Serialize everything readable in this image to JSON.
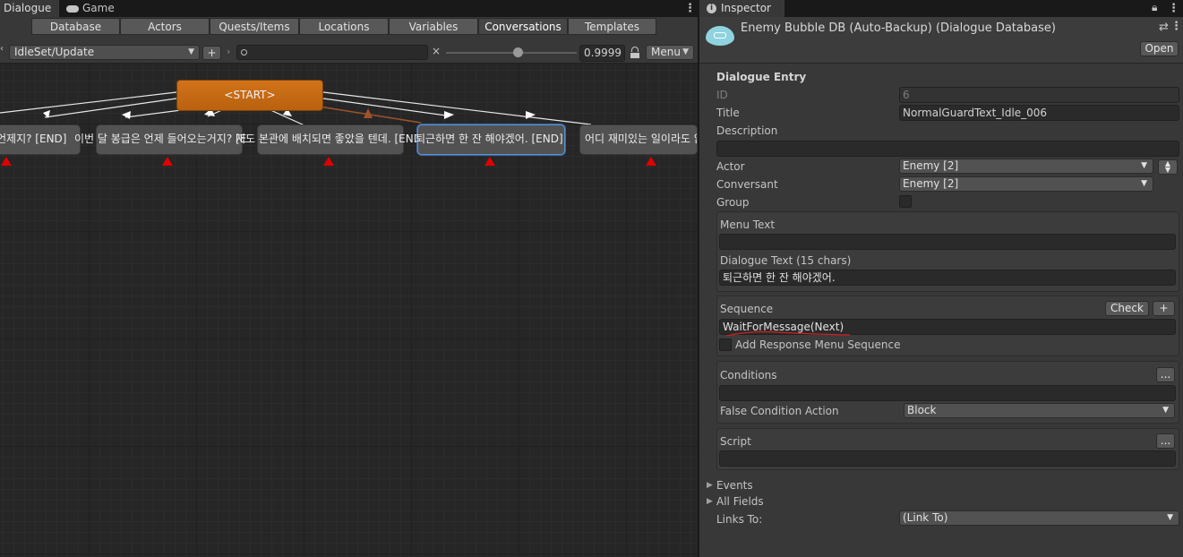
{
  "window_tabs": {
    "dialogue": "Dialogue",
    "game": "Game"
  },
  "db_tabs": [
    "Database",
    "Actors",
    "Quests/Items",
    "Locations",
    "Variables",
    "Conversations",
    "Templates"
  ],
  "conversation_select": "IdleSet/Update",
  "add_label": "+",
  "search": {
    "value": "",
    "clear": "×"
  },
  "zoom_value": "0.9999",
  "zoom_level": 0.55,
  "menu_label": "Menu",
  "start_node": "<START>",
  "nodes": [
    {
      "text": " 언제지? [END]"
    },
    {
      "text": "이번 달 봉급은 언제 들어오는거지? [END]"
    },
    {
      "text": "저도 본관에 배치되면 좋았을 텐데. [END]"
    },
    {
      "text": "퇴근하면 한 잔 해야겠어.  [END]"
    },
    {
      "text": "어디 재미있는 일이라도 없나"
    }
  ],
  "inspector": {
    "tab": "Inspector",
    "title": "Enemy Bubble DB (Auto-Backup) (Dialogue Database)",
    "open": "Open",
    "section": "Dialogue Entry",
    "id_label": "ID",
    "id_value": "6",
    "title_label": "Title",
    "title_value": "NormalGuardText_Idle_006",
    "description_label": "Description",
    "description_value": "",
    "actor_label": "Actor",
    "actor_value": "Enemy [2]",
    "conversant_label": "Conversant",
    "conversant_value": "Enemy [2]",
    "group_label": "Group",
    "menu_text_label": "Menu Text",
    "menu_text_value": "",
    "dialogue_text_label": "Dialogue Text (15 chars)",
    "dialogue_text_value": "퇴근하면 한 잔 해야겠어.",
    "sequence_label": "Sequence",
    "check_label": "Check",
    "plus_label": "+",
    "sequence_value": "WaitForMessage(Next)",
    "add_response_label": "Add Response Menu Sequence",
    "conditions_label": "Conditions",
    "ellipsis": "...",
    "conditions_value": "",
    "false_condition_label": "False Condition Action",
    "false_condition_value": "Block",
    "script_label": "Script",
    "script_value": "",
    "events_label": "Events",
    "all_fields_label": "All Fields",
    "links_to_label": "Links To:",
    "links_to_value": "(Link To)"
  },
  "colors": {
    "start_node": "#c86b15",
    "selection": "#5a8fd0",
    "warning_marker": "#e00000",
    "link_active": "#a0522d"
  }
}
